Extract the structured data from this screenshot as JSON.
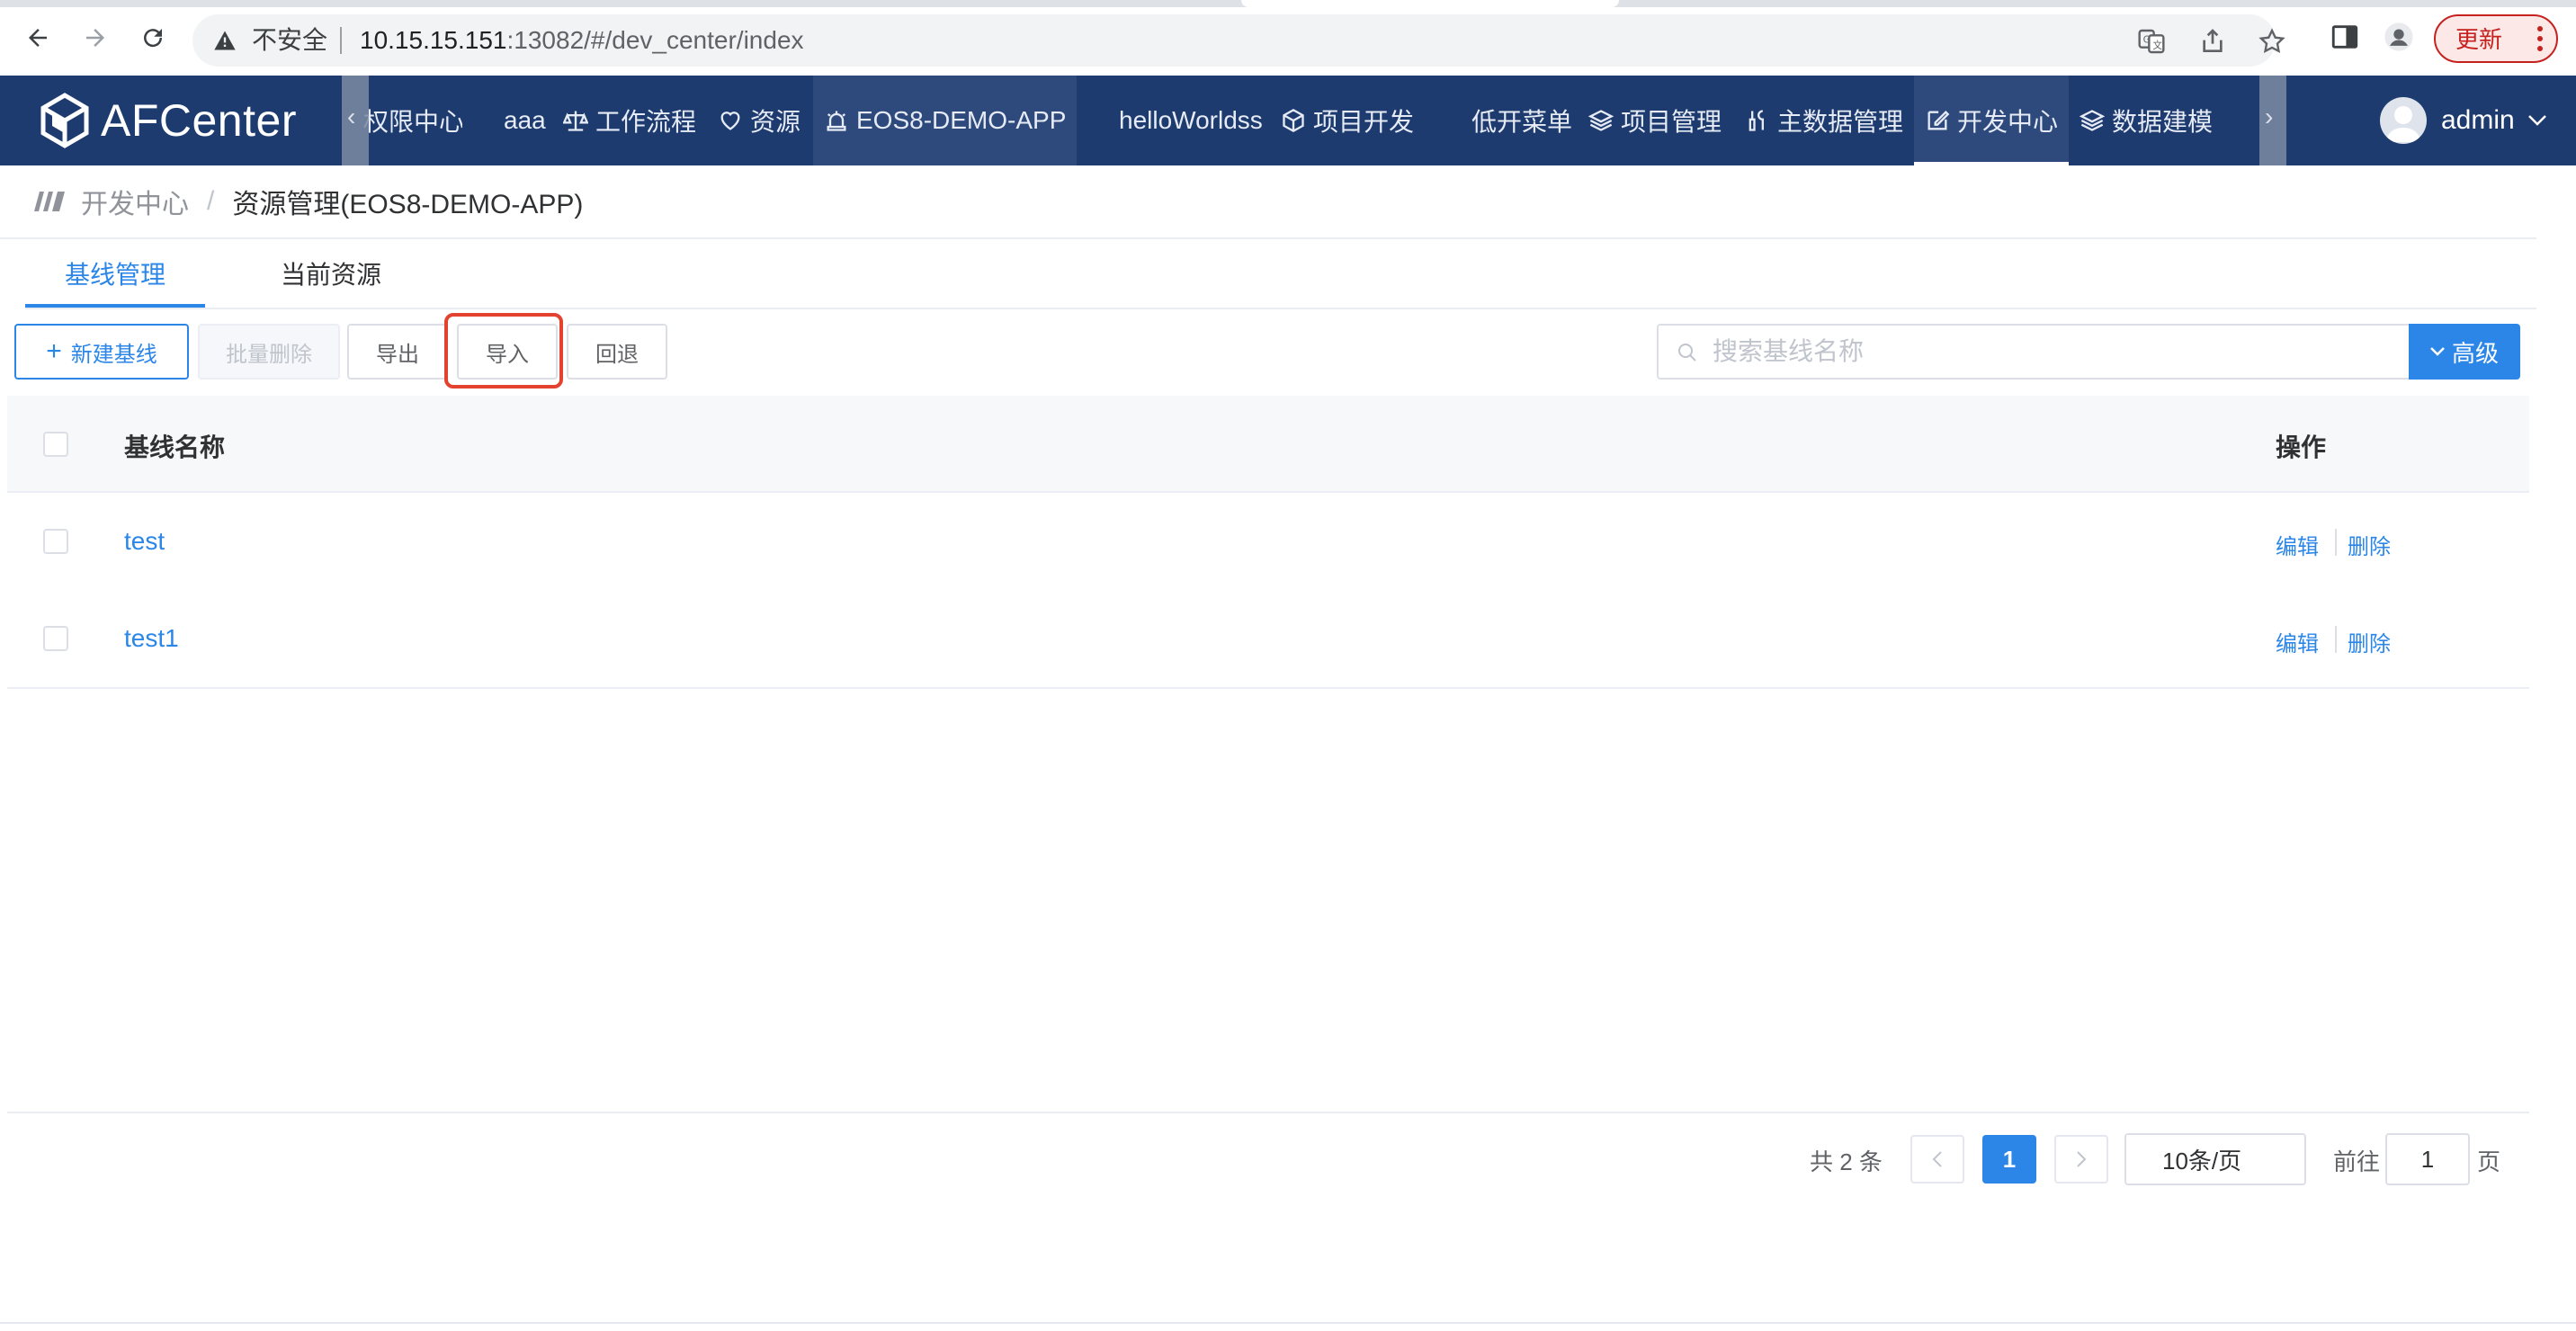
{
  "browser": {
    "security_label": "不安全",
    "url_host": "10.15.15.151",
    "url_rest": ":13082/#/dev_center/index",
    "update_label": "更新"
  },
  "header": {
    "brand": "AFCenter",
    "menu": [
      {
        "label": "权限中心",
        "icon": ""
      },
      {
        "label": "aaa",
        "icon": ""
      },
      {
        "label": "工作流程",
        "icon": "scale-icon"
      },
      {
        "label": "资源",
        "icon": "heart-icon"
      },
      {
        "label": "EOS8-DEMO-APP",
        "icon": "alarm-icon"
      },
      {
        "label": "helloWorldss",
        "icon": ""
      },
      {
        "label": "项目开发",
        "icon": "cube-icon"
      },
      {
        "label": "低开菜单",
        "icon": ""
      },
      {
        "label": "项目管理",
        "icon": "layers-icon"
      },
      {
        "label": "主数据管理",
        "icon": "tools-icon"
      },
      {
        "label": "开发中心",
        "icon": "edit-icon"
      },
      {
        "label": "数据建模",
        "icon": "layers-icon"
      }
    ],
    "username": "admin"
  },
  "breadcrumb": {
    "parent": "开发中心",
    "separator": "/",
    "current": "资源管理(EOS8-DEMO-APP)"
  },
  "tabs": [
    "基线管理",
    "当前资源"
  ],
  "toolbar": {
    "new_baseline": "新建基线",
    "batch_delete": "批量删除",
    "export": "导出",
    "import": "导入",
    "rollback": "回退",
    "search_placeholder": "搜索基线名称",
    "advanced": "高级"
  },
  "table": {
    "col_name": "基线名称",
    "col_ops": "操作",
    "rows": [
      {
        "name": "test",
        "edit": "编辑",
        "delete": "删除"
      },
      {
        "name": "test1",
        "edit": "编辑",
        "delete": "删除"
      }
    ]
  },
  "pagination": {
    "total_text": "共 2 条",
    "current_page": "1",
    "page_size": "10条/页",
    "goto_label": "前往",
    "goto_value": "1",
    "page_suffix": "页"
  },
  "colors": {
    "primary": "#2b86e8",
    "header_bg": "#1e3b6f",
    "highlight": "#e2422e"
  }
}
